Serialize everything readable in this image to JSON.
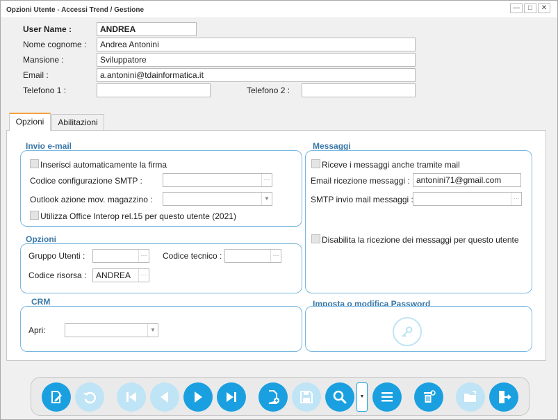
{
  "window": {
    "title": "Opzioni Utente - Accessi Trend / Gestione"
  },
  "form": {
    "username_label": "User Name :",
    "username_value": "ANDREA",
    "fullname_label": "Nome cognome :",
    "fullname_value": "Andrea Antonini",
    "role_label": "Mansione :",
    "role_value": "Sviluppatore",
    "email_label": "Email :",
    "email_value": "a.antonini@tdainformatica.it",
    "phone1_label": "Telefono 1 :",
    "phone1_value": "",
    "phone2_label": "Telefono 2 :",
    "phone2_value": ""
  },
  "tabs": [
    {
      "label": "Opzioni",
      "active": true
    },
    {
      "label": "Abilitazioni",
      "active": false
    }
  ],
  "email_section": {
    "title": "Invio e-mail",
    "auto_signature_label": "Inserisci automaticamente la firma",
    "smtp_code_label": "Codice configurazione SMTP :",
    "smtp_code_value": "",
    "outlook_action_label": "Outlook azione mov. magazzino :",
    "outlook_action_value": "",
    "office_interop_label": "Utilizza Office Interop rel.15 per questo utente (2021)"
  },
  "options_section": {
    "title": "Opzioni",
    "user_group_label": "Gruppo Utenti :",
    "user_group_value": "",
    "tech_code_label": "Codice tecnico :",
    "tech_code_value": "",
    "resource_code_label": "Codice risorsa :",
    "resource_code_value": "ANDREA"
  },
  "crm_section": {
    "title": "CRM",
    "open_label": "Apri:",
    "open_value": ""
  },
  "messages_section": {
    "title": "Messaggi",
    "receive_mail_label": "Riceve i messaggi anche tramite mail",
    "receive_email_label": "Email ricezione messaggi :",
    "receive_email_value": "antonini71@gmail.com",
    "smtp_messages_label": "SMTP invio mail messaggi :",
    "smtp_messages_value": "",
    "disable_label": "Disabilita la ricezione dei messaggi per questo utente"
  },
  "password_section": {
    "title": "Imposta o modifica Password"
  },
  "toolbar": {
    "buttons": [
      {
        "icon": "edit-icon",
        "enabled": true
      },
      {
        "icon": "undo-icon",
        "enabled": false
      },
      {
        "icon": "first-record-icon",
        "enabled": false
      },
      {
        "icon": "previous-record-icon",
        "enabled": false
      },
      {
        "icon": "next-record-icon",
        "enabled": true
      },
      {
        "icon": "last-record-icon",
        "enabled": true
      },
      {
        "icon": "new-document-icon",
        "enabled": true
      },
      {
        "icon": "save-icon",
        "enabled": false
      },
      {
        "icon": "search-icon",
        "enabled": true
      },
      {
        "icon": "list-icon",
        "enabled": true
      },
      {
        "icon": "delete-icon",
        "enabled": true
      },
      {
        "icon": "open-folder-icon",
        "enabled": false
      },
      {
        "icon": "exit-icon",
        "enabled": true
      }
    ]
  },
  "colors": {
    "accent": "#1aa0e0",
    "section_title": "#3a78a8",
    "active_tab": "#f5a23a"
  }
}
